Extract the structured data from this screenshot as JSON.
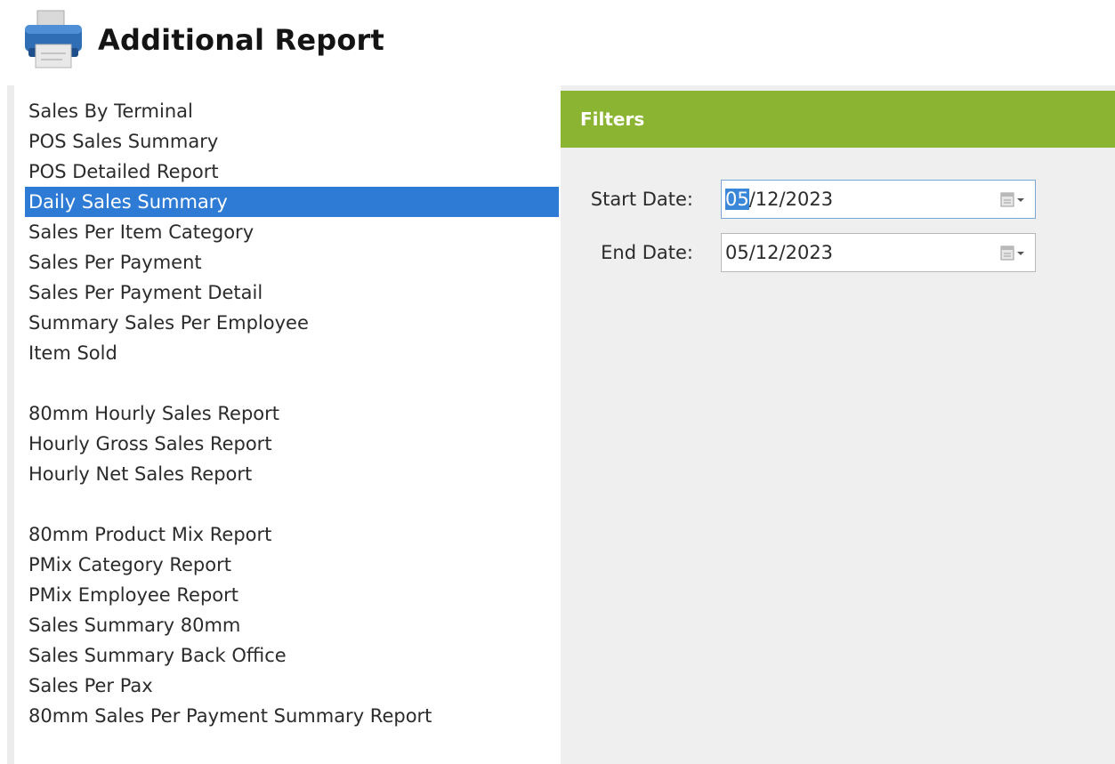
{
  "header": {
    "title": "Additional Report",
    "icon": "printer-icon"
  },
  "report_list": {
    "groups": [
      {
        "items": [
          {
            "label": "Sales By Terminal",
            "selected": false
          },
          {
            "label": "POS Sales Summary",
            "selected": false
          },
          {
            "label": "POS Detailed Report",
            "selected": false
          },
          {
            "label": "Daily Sales Summary",
            "selected": true
          },
          {
            "label": "Sales Per Item Category",
            "selected": false
          },
          {
            "label": "Sales Per Payment",
            "selected": false
          },
          {
            "label": "Sales Per Payment Detail",
            "selected": false
          },
          {
            "label": "Summary Sales Per Employee",
            "selected": false
          },
          {
            "label": "Item Sold",
            "selected": false
          }
        ]
      },
      {
        "items": [
          {
            "label": "80mm Hourly Sales Report",
            "selected": false
          },
          {
            "label": "Hourly Gross Sales Report",
            "selected": false
          },
          {
            "label": "Hourly Net Sales Report",
            "selected": false
          }
        ]
      },
      {
        "items": [
          {
            "label": "80mm Product Mix Report",
            "selected": false
          },
          {
            "label": "PMix Category Report",
            "selected": false
          },
          {
            "label": "PMix Employee Report",
            "selected": false
          },
          {
            "label": "Sales Summary 80mm",
            "selected": false
          },
          {
            "label": "Sales Summary Back Office",
            "selected": false
          },
          {
            "label": "Sales Per Pax",
            "selected": false
          },
          {
            "label": "80mm Sales Per Payment Summary Report",
            "selected": false
          }
        ]
      }
    ],
    "selected_color": "#2e7bd6"
  },
  "filters": {
    "title": "Filters",
    "header_color": "#8ab431",
    "start_date": {
      "label": "Start Date:",
      "value_selected_part": "05",
      "value_rest": "/12/2023",
      "calendar_icon": "calendar-dropdown-icon"
    },
    "end_date": {
      "label": "End Date:",
      "value": "05/12/2023",
      "calendar_icon": "calendar-dropdown-icon"
    }
  }
}
